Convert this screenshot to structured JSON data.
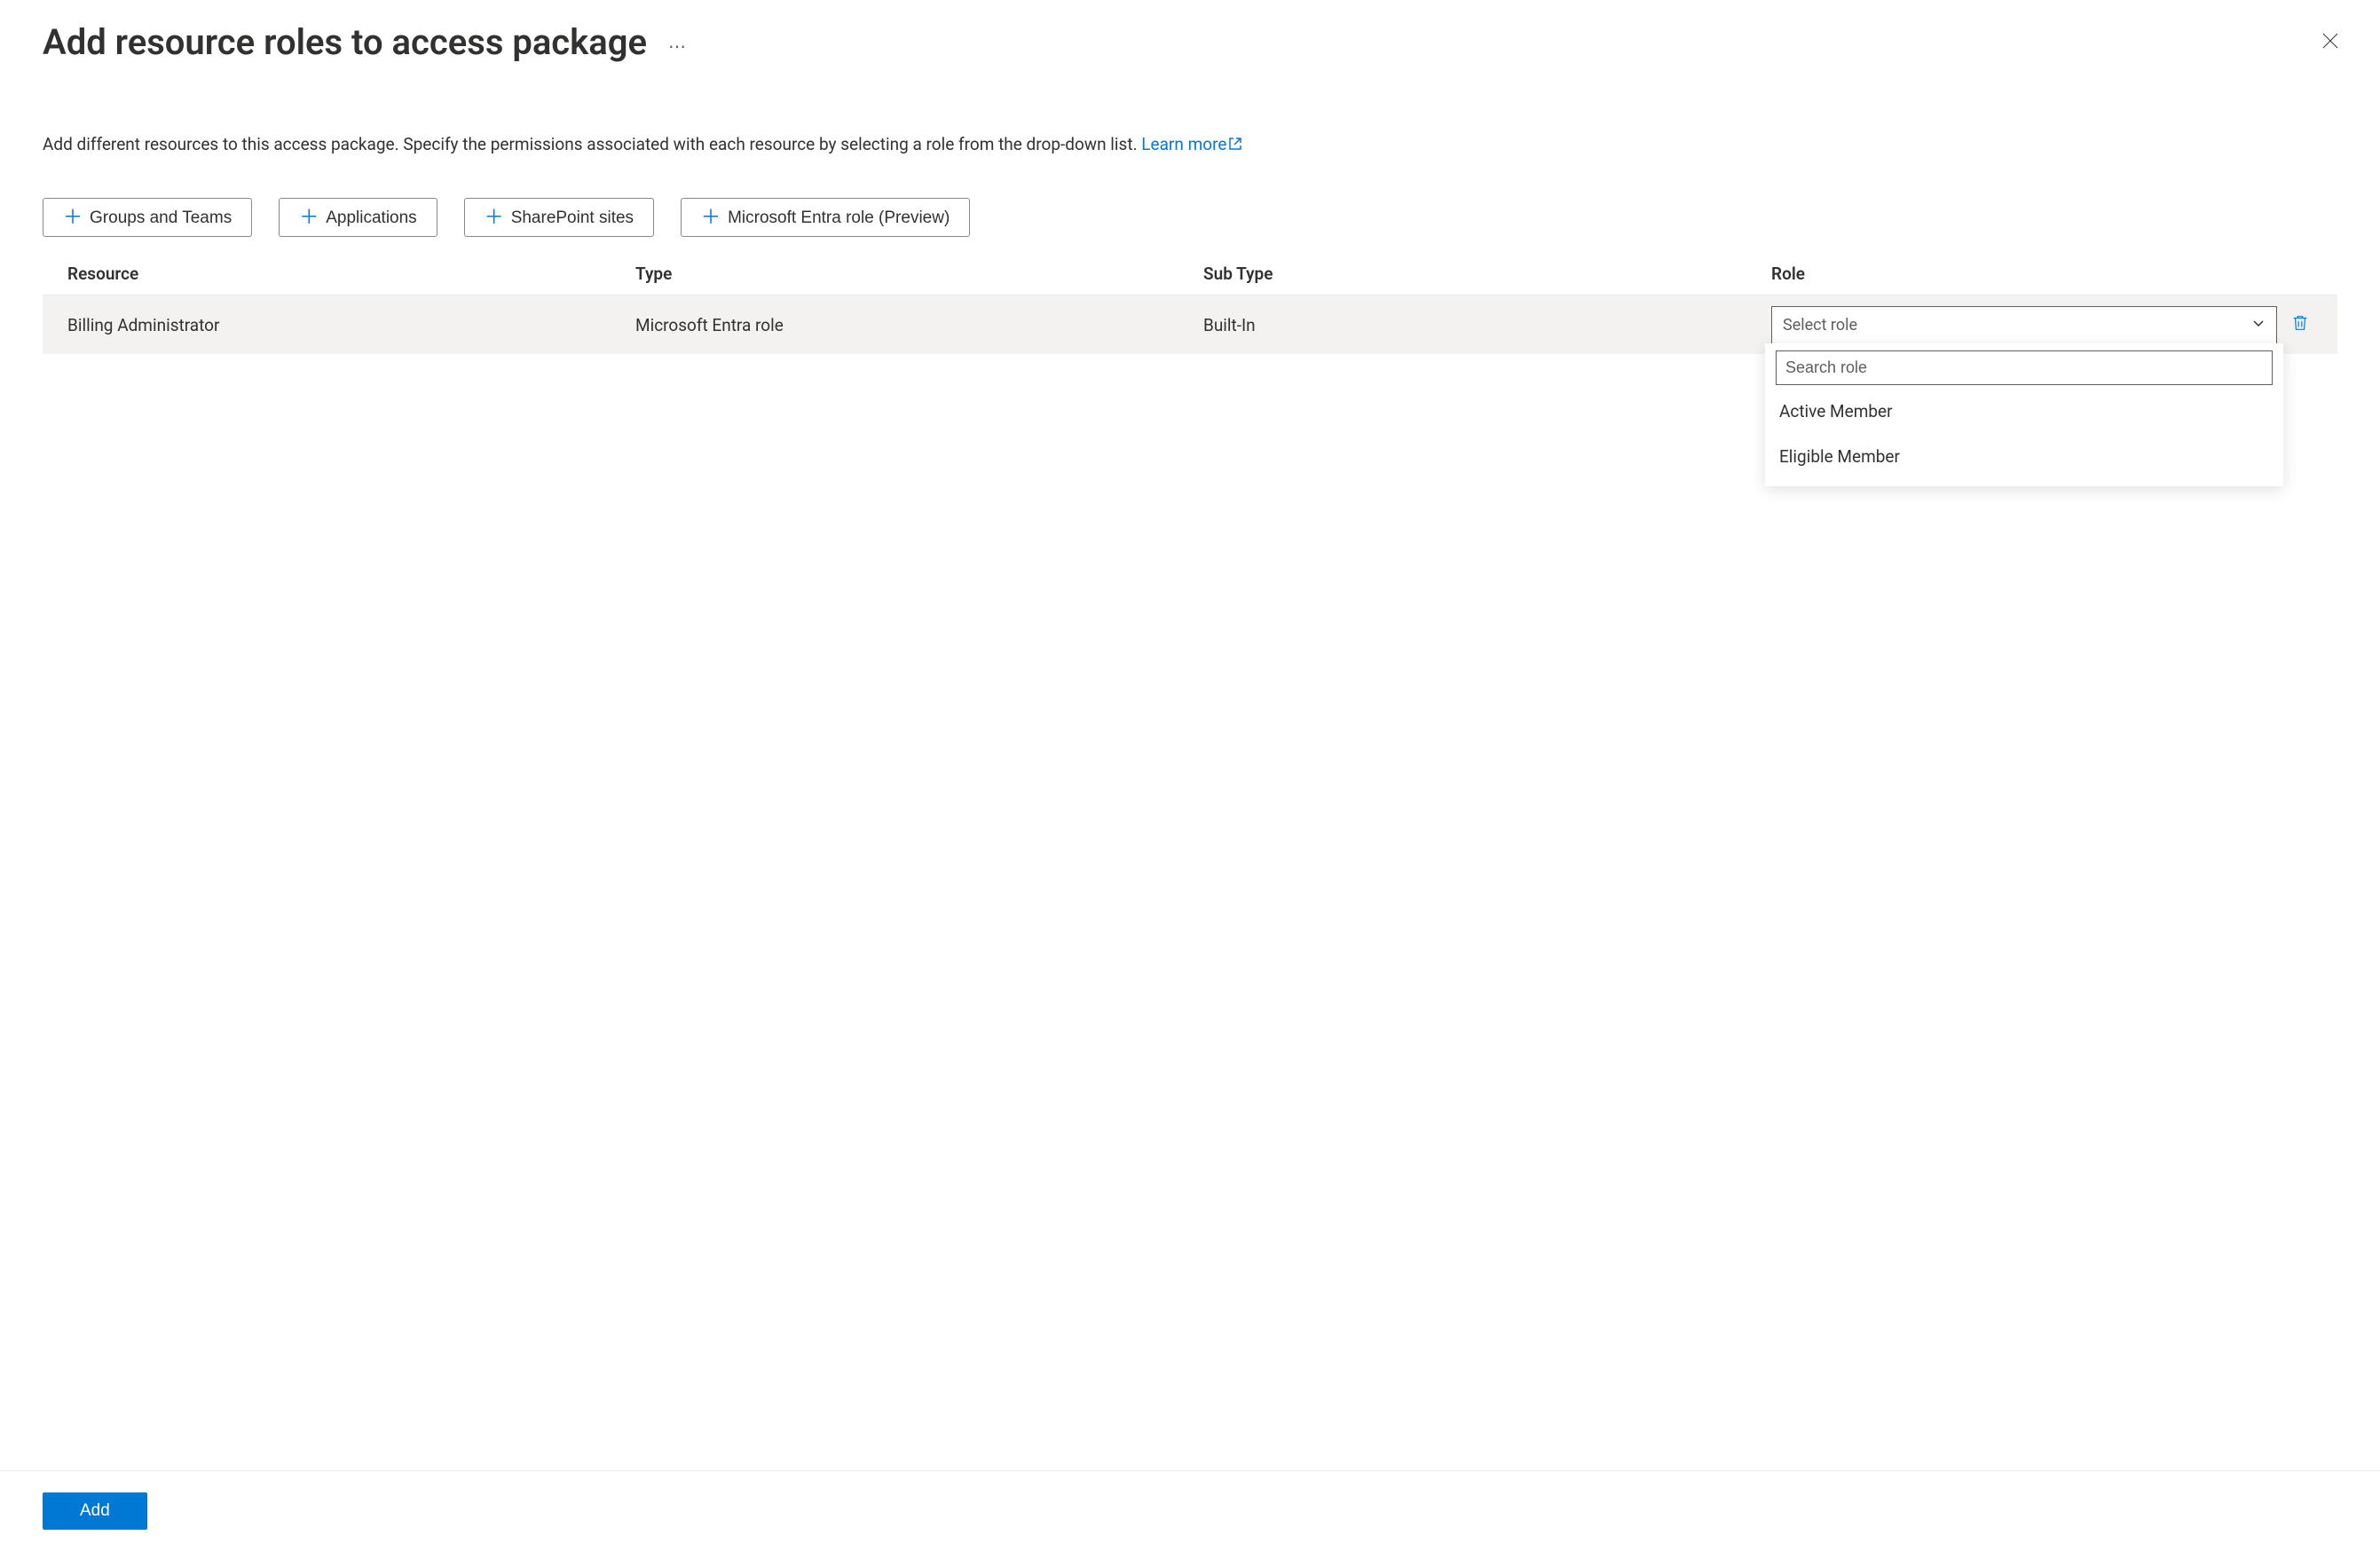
{
  "header": {
    "title": "Add resource roles to access package"
  },
  "description": {
    "text": "Add different resources to this access package. Specify the permissions associated with each resource by selecting a role from the drop-down list. ",
    "link_text": "Learn more"
  },
  "buttons": {
    "groups": "Groups and Teams",
    "applications": "Applications",
    "sharepoint": "SharePoint sites",
    "entra_role": "Microsoft Entra role (Preview)"
  },
  "table": {
    "headers": {
      "resource": "Resource",
      "type": "Type",
      "subtype": "Sub Type",
      "role": "Role"
    },
    "rows": [
      {
        "resource": "Billing Administrator",
        "type": "Microsoft Entra role",
        "subtype": "Built-In",
        "role_placeholder": "Select role"
      }
    ]
  },
  "dropdown": {
    "search_placeholder": "Search role",
    "options": [
      "Active Member",
      "Eligible Member"
    ]
  },
  "footer": {
    "add_label": "Add"
  }
}
